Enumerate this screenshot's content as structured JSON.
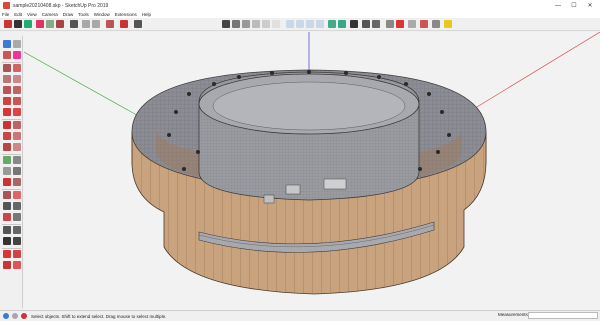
{
  "window": {
    "title": "sample20210408.skp - SketchUp Pro 2019",
    "minimize_glyph": "—",
    "maximize_glyph": "☐",
    "close_glyph": "✕"
  },
  "menu": {
    "items": [
      "File",
      "Edit",
      "View",
      "Camera",
      "Draw",
      "Tools",
      "Window",
      "Extensions",
      "Help"
    ]
  },
  "toolbar": {
    "style_ticks": "1  2  3  4  5  6  7  8  9  0",
    "icons": [
      "select-icon",
      "eraser-icon",
      "paint-icon",
      "line-icon",
      "rectangle-icon",
      "circle-icon",
      "pushpull-icon",
      "offset-icon",
      "move-icon",
      "rotate-icon",
      "scale-icon",
      "orbit-icon",
      "pan-icon",
      "zoom-icon",
      "zoom-extents-icon",
      "prev-view-icon",
      "iso-view-icon",
      "top-view-icon",
      "front-view-icon",
      "right-view-icon",
      "back-view-icon",
      "left-view-icon",
      "xray-icon",
      "hidden-line-icon",
      "shaded-icon",
      "textured-icon",
      "monochrome-icon",
      "components-icon",
      "warehouse-icon",
      "extension-icon",
      "ruby-icon",
      "lightbulb-icon"
    ]
  },
  "status": {
    "hint": "Select objects. Shift to extend select. Drag mouse to select multiple.",
    "measurements_label": "Measurements",
    "measurements_value": ""
  },
  "colors": {
    "wall_wood": "#c9a27e",
    "wall_shade": "#a77f60",
    "glass": "#8f9097",
    "axis_red": "#d23b3b",
    "axis_green": "#36a836",
    "axis_blue": "#3b3bd2"
  }
}
